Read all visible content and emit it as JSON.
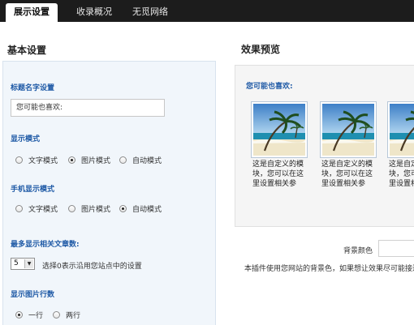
{
  "tabs": [
    {
      "label": "展示设置",
      "active": true
    },
    {
      "label": "收录概况",
      "active": false
    },
    {
      "label": "无觅网络",
      "active": false
    }
  ],
  "basic_settings": {
    "title": "基本设置",
    "title_setting": {
      "label": "标题名字设置",
      "value": "您可能也喜欢:"
    },
    "display_mode": {
      "label": "显示模式",
      "options": [
        "文字模式",
        "图片模式",
        "自动模式"
      ],
      "selected": "图片模式"
    },
    "mobile_mode": {
      "label": "手机显示模式",
      "options": [
        "文字模式",
        "图片模式",
        "自动模式"
      ],
      "selected": "自动模式"
    },
    "max_posts": {
      "label": "最多显示相关文章数:",
      "value": "5",
      "hint": "选择0表示沿用您站点中的设置"
    },
    "image_rows": {
      "label": "显示图片行数",
      "options": [
        "一行",
        "两行"
      ],
      "selected": "一行"
    }
  },
  "preview": {
    "title": "效果预览",
    "heading": "您可能也喜欢:",
    "cards": [
      {
        "text": "这是自定义的模块，您可以在这里设置相关参"
      },
      {
        "text": "这是自定义的模块，您可以在这里设置相关参"
      },
      {
        "text": "这是自定义的模块，您可以在这里设置相关参"
      }
    ],
    "bg_color_label": "背景颜色",
    "note": "本插件使用您网站的背景色，如果想让效果尽可能接近"
  },
  "colors": {
    "tabbar": "#1c1c1c",
    "label_blue": "#1f5aa6",
    "panel_bg": "#f1f6fb"
  },
  "icons": [
    "radio-button-icon",
    "dropdown-arrow-icon",
    "beach-palm-thumbnail"
  ]
}
